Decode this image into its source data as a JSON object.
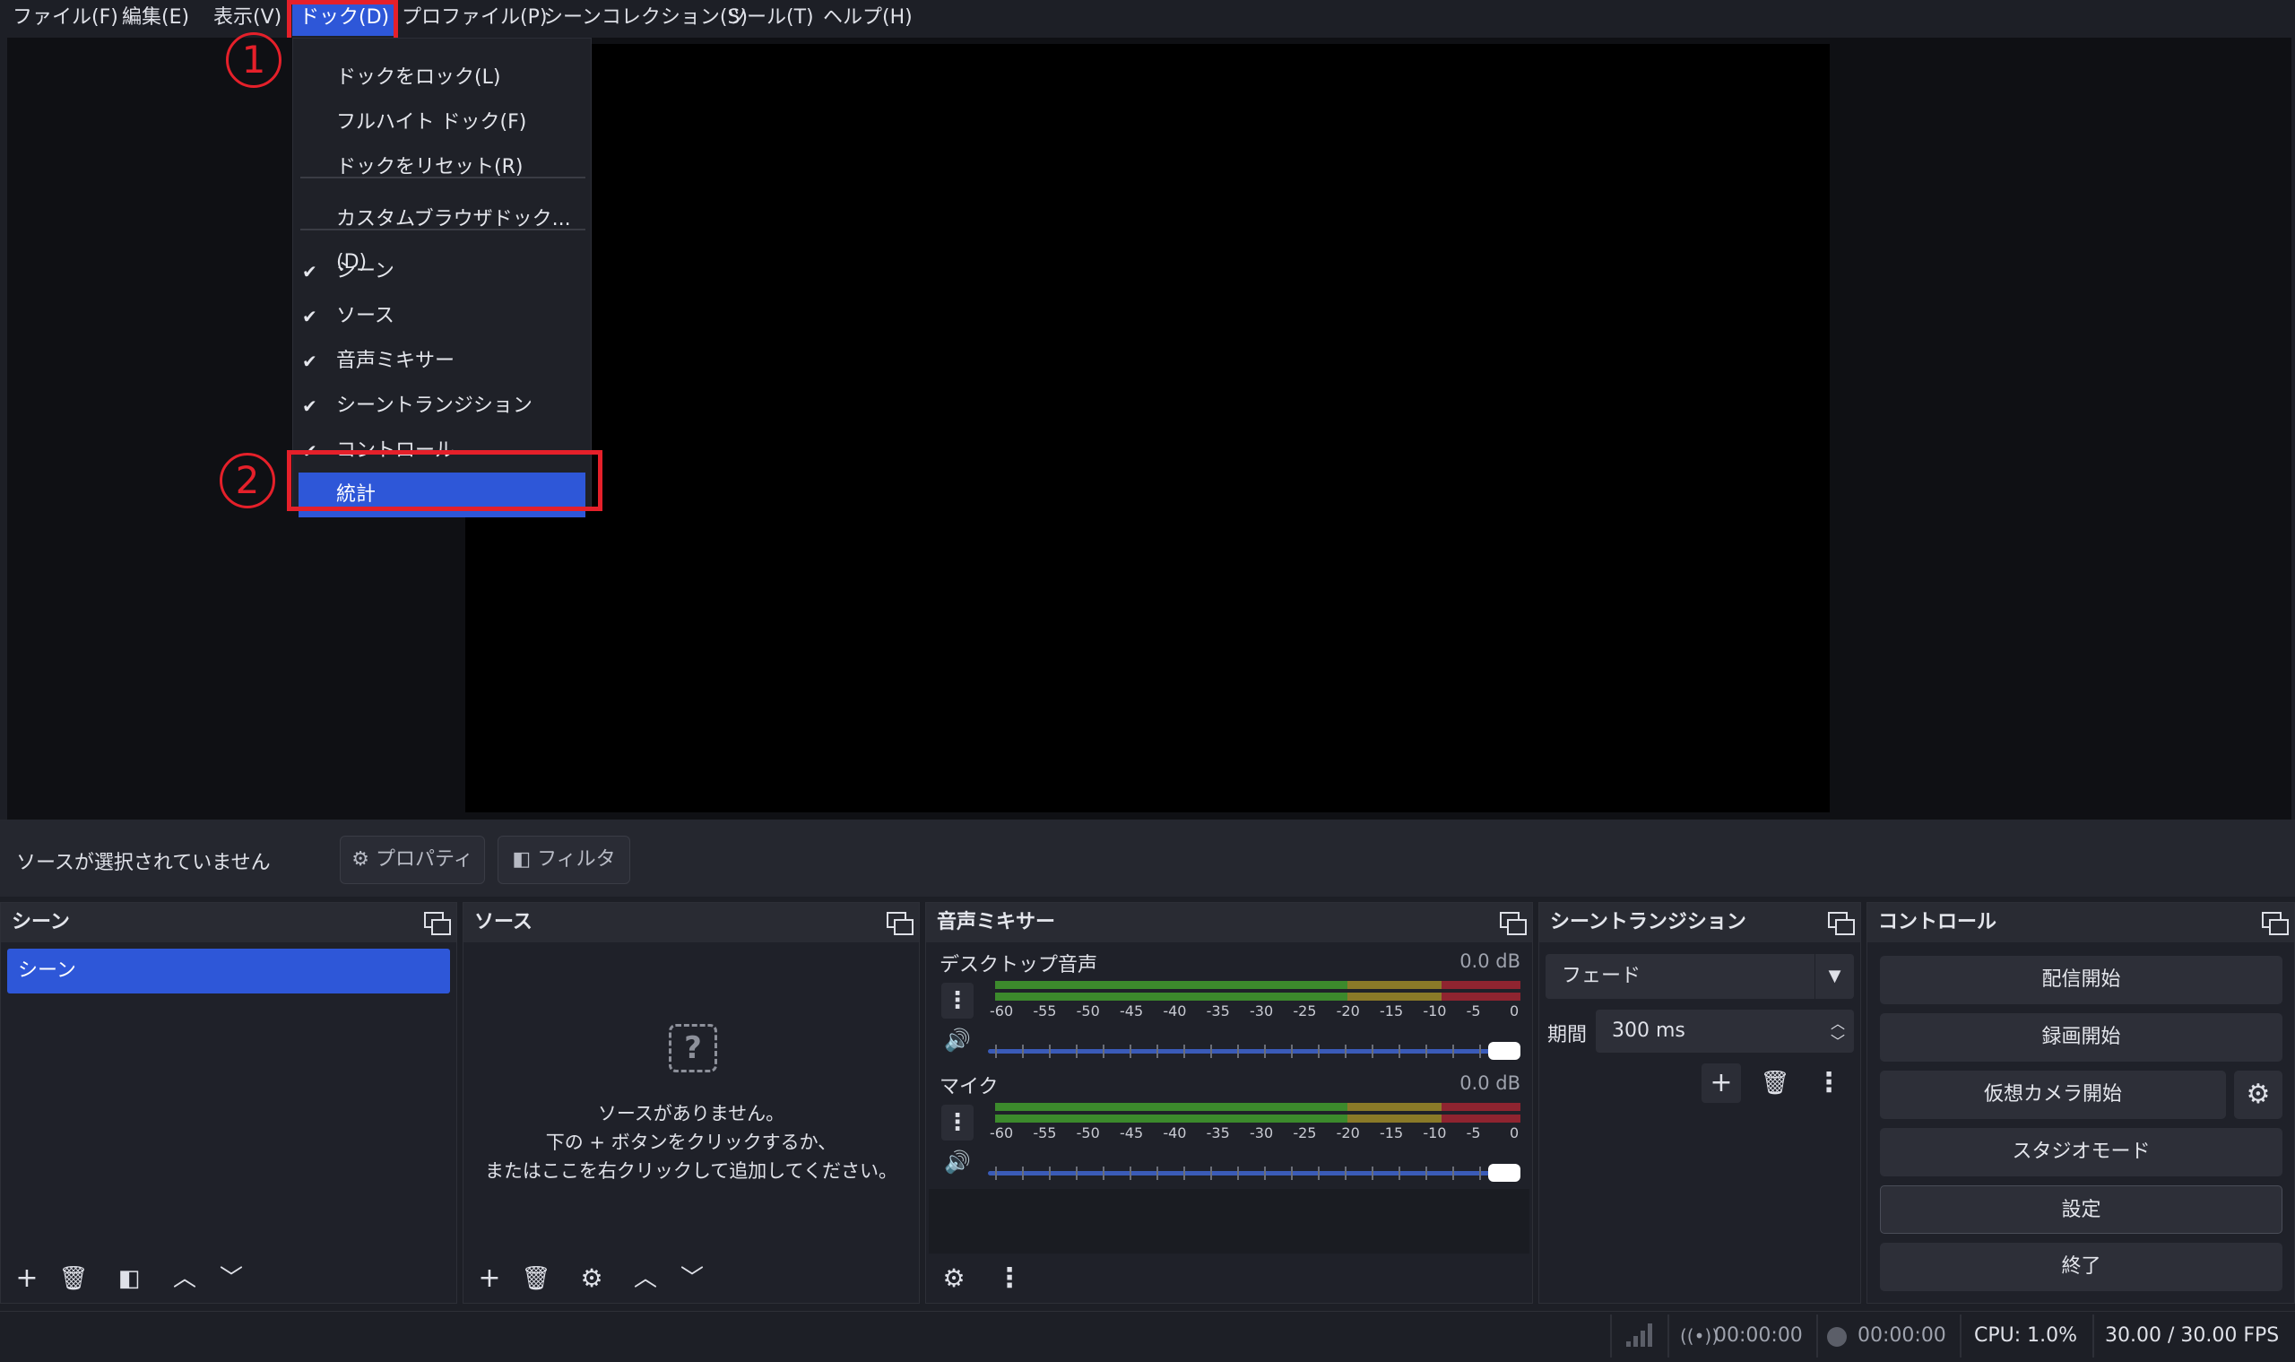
{
  "menubar": {
    "items": [
      "ファイル(F)",
      "編集(E)",
      "表示(V)",
      "ドック(D)",
      "プロファイル(P)",
      "シーンコレクション(S)",
      "ツール(T)",
      "ヘルプ(H)"
    ]
  },
  "dock_menu": {
    "items": [
      "ドックをロック(L)",
      "フルハイト ドック(F)",
      "ドックをリセット(R)",
      "カスタムブラウザドック...(D)",
      "シーン",
      "ソース",
      "音声ミキサー",
      "シーントランジション",
      "コントロール",
      "統計"
    ],
    "check": "✔"
  },
  "annotations": {
    "one": "1",
    "two": "2"
  },
  "source_bar": {
    "label": "ソースが選択されていません",
    "properties": "プロパティ",
    "filters": "フィルタ"
  },
  "scenes": {
    "title": "シーン",
    "items": [
      "シーン"
    ]
  },
  "sources": {
    "title": "ソース",
    "empty_line1": "ソースがありません。",
    "empty_line2": "下の + ボタンをクリックするか、",
    "empty_line3": "またはここを右クリックして追加してください。"
  },
  "mixer": {
    "title": "音声ミキサー",
    "channels": [
      {
        "name": "デスクトップ音声",
        "db": "0.0 dB"
      },
      {
        "name": "マイク",
        "db": "0.0 dB"
      }
    ],
    "ticks": [
      "-60",
      "-55",
      "-50",
      "-45",
      "-40",
      "-35",
      "-30",
      "-25",
      "-20",
      "-15",
      "-10",
      "-5",
      "0"
    ],
    "volume_fraction": 1.0
  },
  "transitions": {
    "title": "シーントランジション",
    "selected": "フェード",
    "duration_label": "期間",
    "duration_value": "300 ms"
  },
  "controls": {
    "title": "コントロール",
    "start_stream": "配信開始",
    "start_record": "録画開始",
    "start_vcam": "仮想カメラ開始",
    "studio_mode": "スタジオモード",
    "settings": "設定",
    "exit": "終了"
  },
  "status": {
    "stream_time": "00:00:00",
    "record_time": "00:00:00",
    "cpu": "CPU: 1.0%",
    "fps": "30.00 / 30.00 FPS"
  },
  "colors": {
    "accent": "#2e57d8",
    "annotation": "#e5202a",
    "meter_green": "#3c8a2c",
    "meter_yellow": "#8a7a28",
    "meter_red": "#8f2430"
  }
}
